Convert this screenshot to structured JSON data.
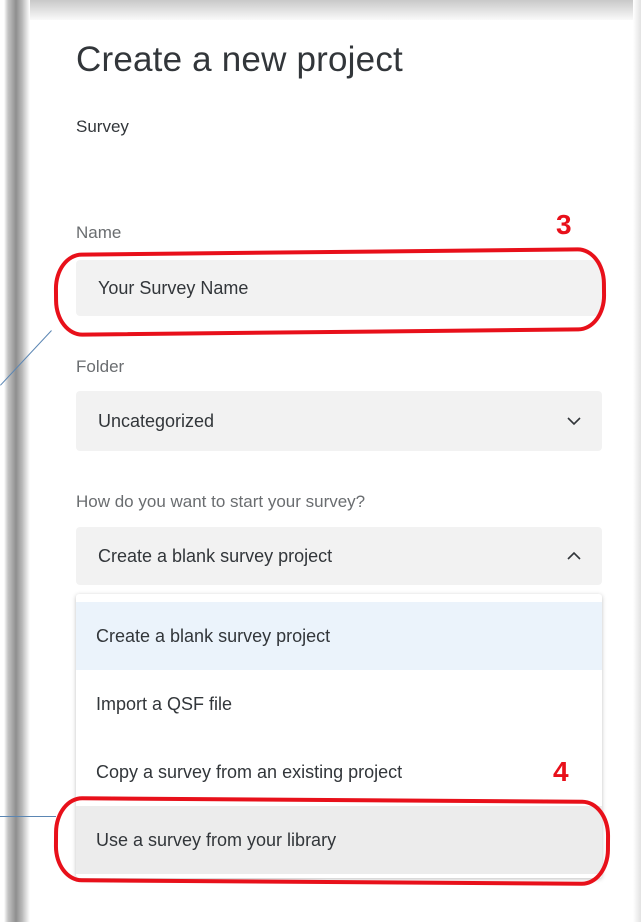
{
  "header": {
    "title": "Create a new project",
    "subtitle": "Survey"
  },
  "form": {
    "name_label": "Name",
    "name_value": "Your Survey Name",
    "folder_label": "Folder",
    "folder_value": "Uncategorized",
    "start_label": "How do you want to start your survey?",
    "start_value": "Create a blank survey project",
    "start_options": [
      "Create a blank survey project",
      "Import a QSF file",
      "Copy a survey from an existing project",
      "Use a survey from your library"
    ]
  },
  "annotations": {
    "step3": "3",
    "step4": "4",
    "highlight_color": "#e8101a"
  },
  "icons": {
    "folder_dropdown": "chevron-down-icon",
    "start_dropdown": "chevron-up-icon"
  },
  "colors": {
    "field_bg": "#f2f2f2",
    "selected_option_bg": "#ebf3fb",
    "hover_option_bg": "#ececec"
  }
}
